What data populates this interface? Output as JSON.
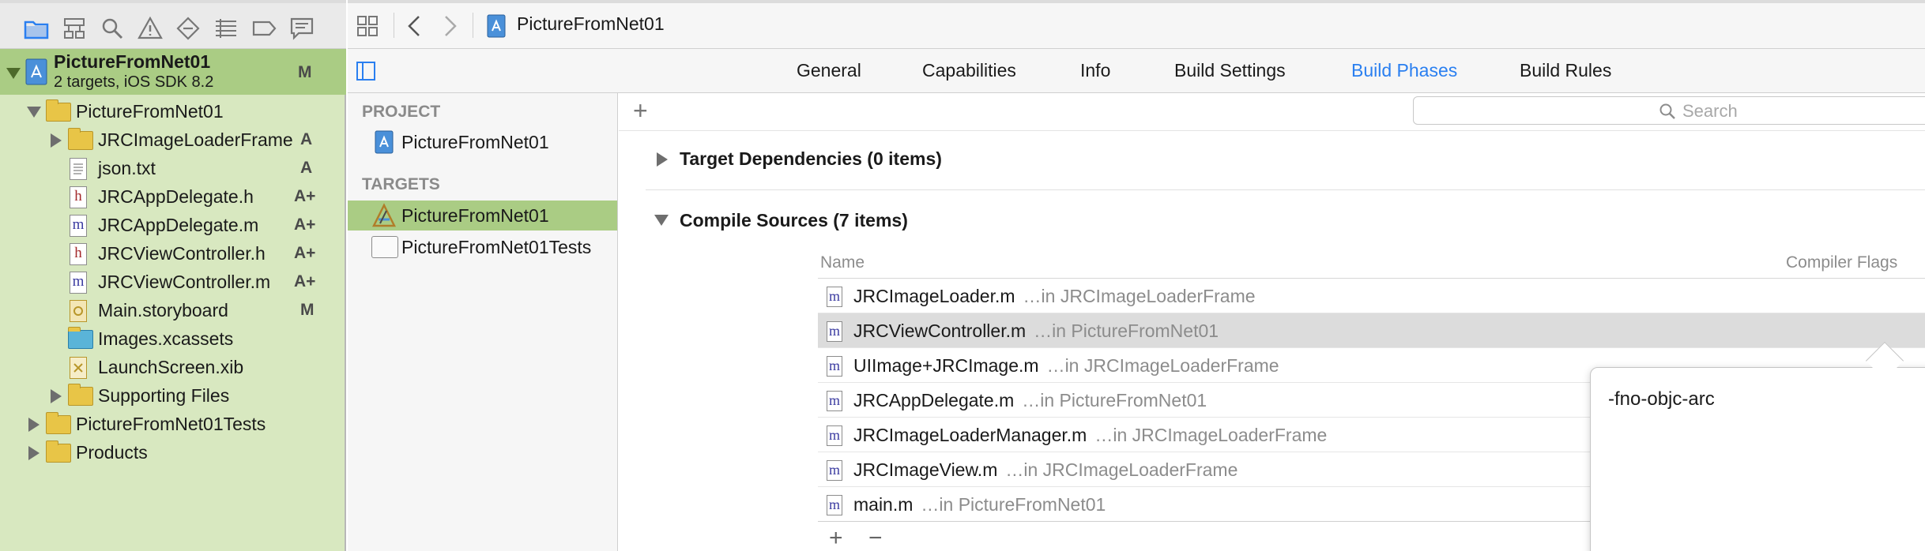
{
  "window": {
    "breadcrumb": "PictureFromNet01"
  },
  "project_navigator": {
    "project": {
      "name": "PictureFromNet01",
      "subtitle": "2 targets, iOS SDK 8.2",
      "badge": "M"
    },
    "items": [
      {
        "label": "PictureFromNet01",
        "badge": "",
        "icon": "folder-icon"
      },
      {
        "label": "JRCImageLoaderFrame",
        "badge": "A",
        "icon": "folder-icon"
      },
      {
        "label": "json.txt",
        "badge": "A",
        "icon": "text-file-icon"
      },
      {
        "label": "JRCAppDelegate.h",
        "badge": "A+",
        "icon": "header-file-icon"
      },
      {
        "label": "JRCAppDelegate.m",
        "badge": "A+",
        "icon": "objc-file-icon"
      },
      {
        "label": "JRCViewController.h",
        "badge": "A+",
        "icon": "header-file-icon"
      },
      {
        "label": "JRCViewController.m",
        "badge": "A+",
        "icon": "objc-file-icon"
      },
      {
        "label": "Main.storyboard",
        "badge": "M",
        "icon": "storyboard-icon"
      },
      {
        "label": "Images.xcassets",
        "badge": "",
        "icon": "asset-catalog-icon"
      },
      {
        "label": "LaunchScreen.xib",
        "badge": "",
        "icon": "xib-file-icon"
      },
      {
        "label": "Supporting Files",
        "badge": "",
        "icon": "folder-icon"
      },
      {
        "label": "PictureFromNet01Tests",
        "badge": "",
        "icon": "folder-icon"
      },
      {
        "label": "Products",
        "badge": "",
        "icon": "folder-icon"
      }
    ]
  },
  "tabs": [
    {
      "label": "General",
      "active": false
    },
    {
      "label": "Capabilities",
      "active": false
    },
    {
      "label": "Info",
      "active": false
    },
    {
      "label": "Build Settings",
      "active": false
    },
    {
      "label": "Build Phases",
      "active": true
    },
    {
      "label": "Build Rules",
      "active": false
    }
  ],
  "targets_list": {
    "project_header": "PROJECT",
    "project_item": "PictureFromNet01",
    "targets_header": "TARGETS",
    "targets": [
      "PictureFromNet01",
      "PictureFromNet01Tests"
    ]
  },
  "build_phases": {
    "add_symbol": "+",
    "search_placeholder": "Search",
    "target_dependencies": "Target Dependencies (0 items)",
    "compile_sources": "Compile Sources (7 items)",
    "col_name": "Name",
    "col_flags": "Compiler Flags",
    "sources": [
      {
        "file": "JRCImageLoader.m",
        "location": "…in JRCImageLoaderFrame",
        "selected": false
      },
      {
        "file": "JRCViewController.m",
        "location": "…in PictureFromNet01",
        "selected": true
      },
      {
        "file": "UIImage+JRCImage.m",
        "location": "…in JRCImageLoaderFrame",
        "selected": false
      },
      {
        "file": "JRCAppDelegate.m",
        "location": "…in PictureFromNet01",
        "selected": false
      },
      {
        "file": "JRCImageLoaderManager.m",
        "location": "…in JRCImageLoaderFrame",
        "selected": false
      },
      {
        "file": "JRCImageView.m",
        "location": "…in JRCImageLoaderFrame",
        "selected": false
      },
      {
        "file": "main.m",
        "location": "…in PictureFromNet01",
        "selected": false
      }
    ],
    "add_button": "+",
    "remove_button": "−",
    "flags_popover_value": "-fno-objc-arc"
  },
  "colors": {
    "accent": "#2a7ff0",
    "navigator_bg": "#d8e8c0",
    "selection_green": "#aacc84"
  }
}
